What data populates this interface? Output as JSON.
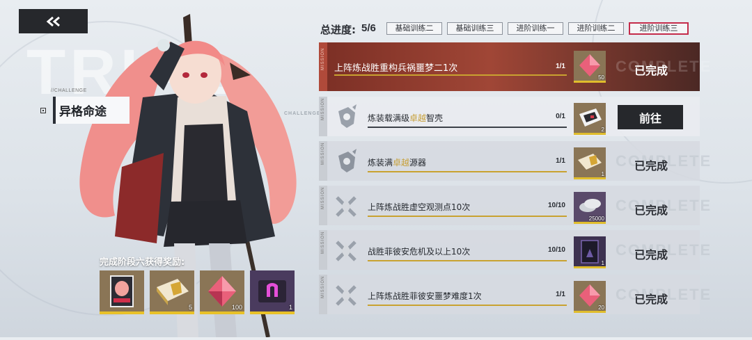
{
  "header": {
    "progress_label": "总进度:",
    "progress_value": "5/6",
    "tabs": [
      {
        "label": "基础训练二",
        "active": false
      },
      {
        "label": "基础训练三",
        "active": false
      },
      {
        "label": "进阶训练一",
        "active": false
      },
      {
        "label": "进阶训练二",
        "active": false
      },
      {
        "label": "进阶训练三",
        "active": true
      }
    ]
  },
  "left": {
    "challenge_tag": "//CHALLENGE",
    "title": "异格命途",
    "ghost_text": "TRIAL",
    "ghost_small": "CHALLENGE"
  },
  "rewards": {
    "title": "完成阶段六获得奖励:",
    "items": [
      {
        "icon": "character-card-icon",
        "qty": ""
      },
      {
        "icon": "record-book-icon",
        "qty": "5"
      },
      {
        "icon": "red-crystal-icon",
        "qty": "100"
      },
      {
        "icon": "magnet-chip-icon",
        "qty": "1"
      }
    ]
  },
  "missions": [
    {
      "side": "MISSION",
      "desc_pre": "上阵炼战胜重构兵祸噩梦二1次",
      "desc_hl": "",
      "desc_post": "",
      "count": "1/1",
      "progress": 1.0,
      "reward_qty": "50",
      "reward_icon": "red-crystal-icon",
      "status": "已完成",
      "ghost": "COMPLETE",
      "state": "featured"
    },
    {
      "side": "MISSION",
      "desc_pre": "炼装载满级",
      "desc_hl": "卓越",
      "desc_post": "智壳",
      "count": "0/1",
      "progress": 0.0,
      "reward_qty": "2",
      "reward_icon": "chip-box-icon",
      "status": "前往",
      "ghost": "",
      "state": "todo"
    },
    {
      "side": "MISSION",
      "desc_pre": "炼装满",
      "desc_hl": "卓越",
      "desc_post": "源器",
      "count": "1/1",
      "progress": 1.0,
      "reward_qty": "1",
      "reward_icon": "record-book-icon",
      "status": "已完成",
      "ghost": "COMPLETE",
      "state": "dim"
    },
    {
      "side": "MISSION",
      "desc_pre": "上阵炼战胜虚空观测点10次",
      "desc_hl": "",
      "desc_post": "",
      "count": "10/10",
      "progress": 1.0,
      "reward_qty": "25000",
      "reward_icon": "silver-coins-icon",
      "status": "已完成",
      "ghost": "COMPLETE",
      "state": "dim"
    },
    {
      "side": "MISSION",
      "desc_pre": "战胜菲彼安危机及以上10次",
      "desc_hl": "",
      "desc_post": "",
      "count": "10/10",
      "progress": 1.0,
      "reward_qty": "1",
      "reward_icon": "dark-card-icon",
      "status": "已完成",
      "ghost": "COMPLETE",
      "state": "dim"
    },
    {
      "side": "MISSION",
      "desc_pre": "上阵炼战胜菲彼安噩梦难度1次",
      "desc_hl": "",
      "desc_post": "",
      "count": "1/1",
      "progress": 1.0,
      "reward_qty": "20",
      "reward_icon": "red-crystal-icon",
      "status": "已完成",
      "ghost": "COMPLETE",
      "state": "dim"
    }
  ],
  "colors": {
    "accent_gold": "#c9a230",
    "active_tab_border": "#c42b4a",
    "featured_bg": "#a04636",
    "button_dark": "#26282c"
  }
}
